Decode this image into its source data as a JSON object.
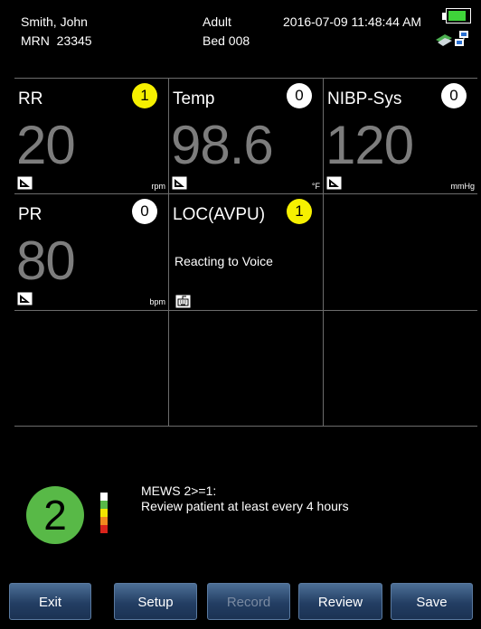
{
  "header": {
    "patient_name": "Smith, John",
    "mrn": "MRN  23345",
    "patient_type": "Adult",
    "bed": "Bed 008",
    "datetime": "2016-07-09 11:48:44 AM",
    "battery_level": 0.85
  },
  "tiles": [
    {
      "label": "RR",
      "score": "1",
      "score_color": "#f6f000",
      "value": "20",
      "unit": "rpm",
      "icon": "trend-icon"
    },
    {
      "label": "Temp",
      "score": "0",
      "score_color": "#ffffff",
      "value": "98.6",
      "unit": "°F",
      "icon": "trend-icon"
    },
    {
      "label": "NIBP-Sys",
      "score": "0",
      "score_color": "#ffffff",
      "value": "120",
      "unit": "mmHg",
      "icon": "trend-icon"
    },
    {
      "label": "PR",
      "score": "0",
      "score_color": "#ffffff",
      "value": "80",
      "unit": "bpm",
      "icon": "trend-icon"
    },
    {
      "label": "LOC(AVPU)",
      "score": "1",
      "score_color": "#f6f000",
      "text": "Reacting to Voice",
      "icon": "keyboard-icon"
    }
  ],
  "mews": {
    "score": "2",
    "line1": "MEWS 2>=1:",
    "line2": "Review patient at least every 4 hours",
    "circle_color": "#58b947"
  },
  "buttons": {
    "exit": "Exit",
    "setup": "Setup",
    "record": "Record",
    "review": "Review",
    "save": "Save"
  },
  "colors": {
    "value_gray": "#7d7d7d",
    "button_blue": "#233e63"
  }
}
